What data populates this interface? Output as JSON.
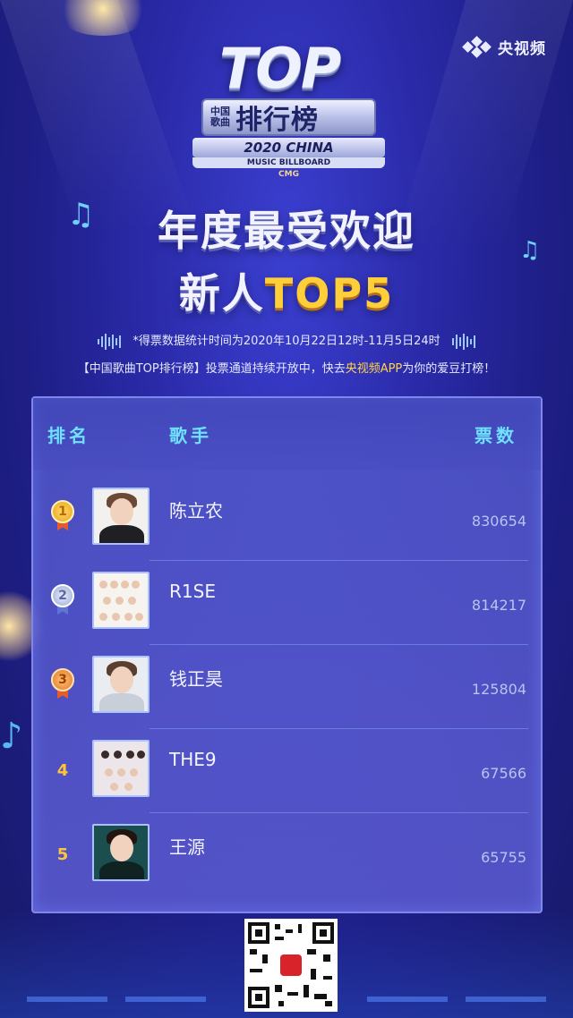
{
  "brand": {
    "label": "央视频"
  },
  "logo": {
    "top": "TOP",
    "small_line1": "中国",
    "small_line2": "歌曲",
    "main": "排行榜",
    "year": "2020 CHINA",
    "sub": "MUSIC BILLBOARD",
    "cmg": "CMG"
  },
  "title": {
    "line1": "年度最受欢迎",
    "line2_white": "新人",
    "line2_yellow": "TOP5"
  },
  "notice": {
    "line1": "*得票数据统计时间为2020年10月22日12时-11月5日24时",
    "line2_prefix": "【中国歌曲TOP排行榜】投票通道持续开放中，快去",
    "line2_highlight": "央视频APP",
    "line2_suffix": "为你的爱豆打榜！"
  },
  "table": {
    "headers": {
      "rank": "排名",
      "singer": "歌手",
      "votes": "票数"
    },
    "rows": [
      {
        "rank": "1",
        "name": "陈立农",
        "votes": "830654",
        "medal": "gold"
      },
      {
        "rank": "2",
        "name": "R1SE",
        "votes": "814217",
        "medal": "silver"
      },
      {
        "rank": "3",
        "name": "钱正昊",
        "votes": "125804",
        "medal": "bronze"
      },
      {
        "rank": "4",
        "name": "THE9",
        "votes": "67566",
        "medal": ""
      },
      {
        "rank": "5",
        "name": "王源",
        "votes": "65755",
        "medal": ""
      }
    ]
  },
  "colors": {
    "accent_cyan": "#6fe1ff",
    "accent_yellow": "#ffcf3a",
    "background": "#2a2aa8"
  }
}
